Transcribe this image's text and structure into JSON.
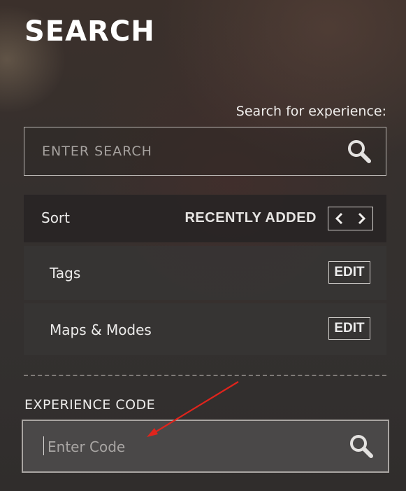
{
  "header": {
    "title": "SEARCH"
  },
  "search": {
    "hint": "Search for experience:",
    "placeholder": "ENTER SEARCH",
    "icon": "search-icon"
  },
  "sort": {
    "label": "Sort",
    "value": "RECENTLY ADDED",
    "prev_icon": "chevron-left-icon",
    "next_icon": "chevron-right-icon"
  },
  "filters": [
    {
      "label": "Tags",
      "action": "EDIT"
    },
    {
      "label": "Maps & Modes",
      "action": "EDIT"
    }
  ],
  "experience_code": {
    "label": "EXPERIENCE CODE",
    "placeholder": "Enter Code",
    "icon": "search-icon"
  },
  "annotation": {
    "type": "arrow",
    "color": "#e0241c",
    "points_to": "experience-code-input"
  }
}
